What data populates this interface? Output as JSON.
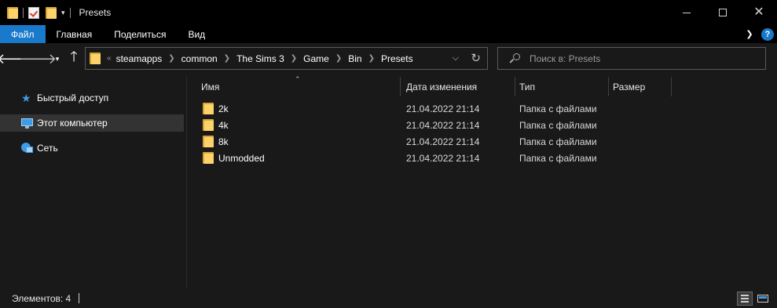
{
  "window": {
    "title": "Presets",
    "controls": {
      "minimize": "minimize",
      "maximize": "maximize",
      "close": "✕"
    }
  },
  "ribbon": {
    "tabs": [
      {
        "label": "Файл",
        "active": true,
        "color": "#1979ca"
      },
      {
        "label": "Главная"
      },
      {
        "label": "Поделиться"
      },
      {
        "label": "Вид"
      }
    ],
    "help_label": "?"
  },
  "address": {
    "overflow": "«",
    "crumbs": [
      "steamapps",
      "common",
      "The Sims 3",
      "Game",
      "Bin",
      "Presets"
    ]
  },
  "search": {
    "placeholder": "Поиск в: Presets"
  },
  "nav": {
    "items": [
      {
        "label": "Быстрый доступ",
        "icon": "star-icon",
        "selected": false
      },
      {
        "label": "Этот компьютер",
        "icon": "computer-icon",
        "selected": true
      },
      {
        "label": "Сеть",
        "icon": "network-icon",
        "selected": false
      }
    ]
  },
  "columns": {
    "name": "Имя",
    "date": "Дата изменения",
    "type": "Тип",
    "size": "Размер"
  },
  "files": [
    {
      "name": "2k",
      "date": "21.04.2022 21:14",
      "type": "Папка с файлами"
    },
    {
      "name": "4k",
      "date": "21.04.2022 21:14",
      "type": "Папка с файлами"
    },
    {
      "name": "8k",
      "date": "21.04.2022 21:14",
      "type": "Папка с файлами"
    },
    {
      "name": "Unmodded",
      "date": "21.04.2022 21:14",
      "type": "Папка с файлами"
    }
  ],
  "status": {
    "items_label": "Элементов: 4"
  },
  "colors": {
    "accent": "#1979ca",
    "background": "#191919",
    "folder": "#fcd36a"
  }
}
